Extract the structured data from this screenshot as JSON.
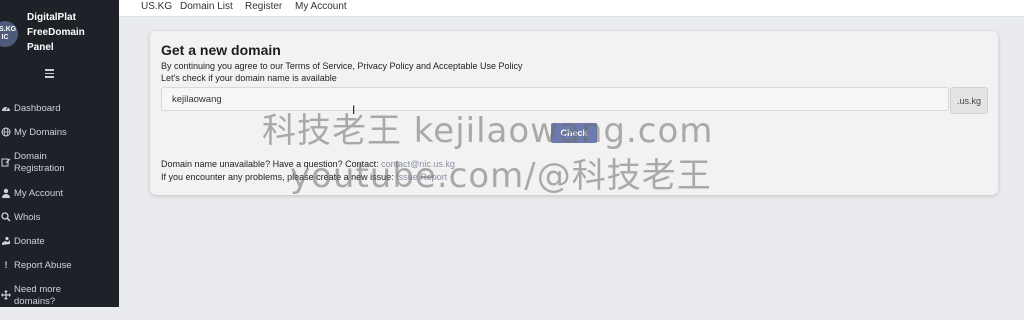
{
  "sidebar": {
    "avatar_text": "US.KG\nIC",
    "brand": "DigitalPlat\nFreeDomain\nPanel",
    "items": [
      {
        "label": "Dashboard",
        "icon": "dashboard-icon"
      },
      {
        "label": "My Domains",
        "icon": "globe-icon"
      },
      {
        "label": "Domain\nRegistration",
        "icon": "edit-icon"
      },
      {
        "label": "My Account",
        "icon": "user-icon"
      },
      {
        "label": "Whois",
        "icon": "search-icon"
      },
      {
        "label": "Donate",
        "icon": "donate-icon"
      },
      {
        "label": "Report Abuse",
        "icon": "exclamation-icon"
      },
      {
        "label": "Need more\ndomains?",
        "icon": "move-icon"
      }
    ]
  },
  "topnav": {
    "items": [
      "US.KG",
      "Domain List",
      "Register",
      "My Account"
    ]
  },
  "card": {
    "title": "Get a new domain",
    "subtitle1": "By continuing you agree to our Terms of Service, Privacy Policy and Acceptable Use Policy",
    "subtitle2": "Let's check if your domain name is available",
    "input_value": "kejilaowang",
    "suffix": ".us.kg",
    "check_label": "Check",
    "unavailable_text": "Domain name unavailable? Have a question? Contact:",
    "contact_link": "contact@nic.us.kg",
    "problem_text": "If you encounter any problems, please create a new issue:",
    "issue_link": "Issue Report"
  },
  "watermark": {
    "line1": "科技老王 kejilaowang.com",
    "line2": "youtube.com/@科技老王"
  },
  "colors": {
    "sidebar_bg": "#1f2128",
    "check_button": "#6d7bb0",
    "link": "#8a8fa4"
  }
}
